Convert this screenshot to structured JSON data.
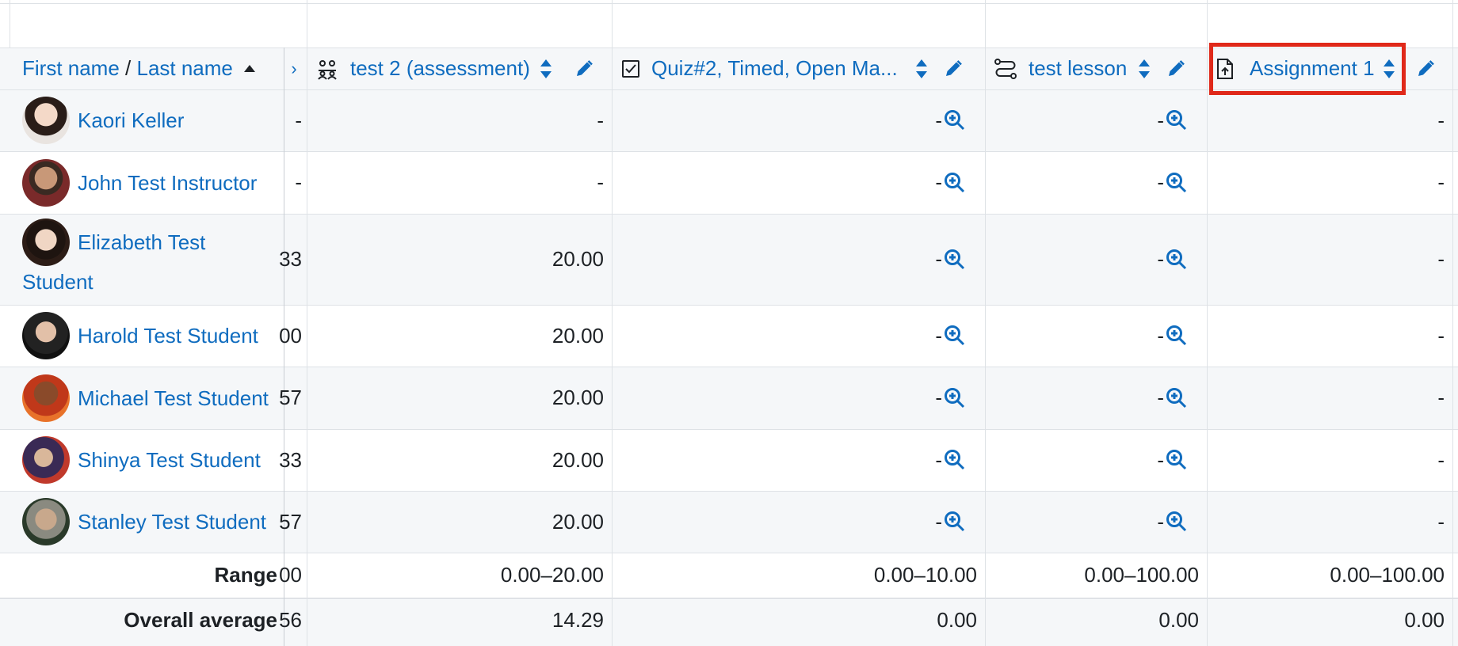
{
  "header": {
    "name_col": {
      "first": "First name",
      "sep": " / ",
      "last": "Last name"
    },
    "partial_col_glyph": "›",
    "columns": [
      {
        "label": "test 2 (assessment)",
        "icon": "workshop-icon"
      },
      {
        "label": "Quiz#2, Timed, Open Ma...",
        "icon": "quiz-checkbox-icon"
      },
      {
        "label": "test lesson",
        "icon": "lesson-path-icon"
      },
      {
        "label": "Assignment 1",
        "icon": "assignment-upload-icon"
      }
    ]
  },
  "students": [
    {
      "name": "Kaori Keller",
      "partial": "-",
      "values": [
        "-",
        "-",
        "-",
        "-"
      ]
    },
    {
      "name": "John Test Instructor",
      "partial": "-",
      "values": [
        "-",
        "-",
        "-",
        "-"
      ]
    },
    {
      "name_line1": "Elizabeth Test",
      "name_line2": "Student",
      "partial": "33",
      "values": [
        "20.00",
        "-",
        "-",
        "-"
      ]
    },
    {
      "name": "Harold Test Student",
      "partial": "00",
      "values": [
        "20.00",
        "-",
        "-",
        "-"
      ]
    },
    {
      "name": "Michael Test Student",
      "partial": "57",
      "values": [
        "20.00",
        "-",
        "-",
        "-"
      ]
    },
    {
      "name": "Shinya Test Student",
      "partial": "33",
      "values": [
        "20.00",
        "-",
        "-",
        "-"
      ]
    },
    {
      "name": "Stanley Test Student",
      "partial": "57",
      "values": [
        "20.00",
        "-",
        "-",
        "-"
      ]
    }
  ],
  "footer": {
    "range": {
      "label": "Range",
      "partial": "00",
      "values": [
        "0.00–20.00",
        "0.00–10.00",
        "0.00–100.00",
        "0.00–100.00"
      ]
    },
    "average": {
      "label": "Overall average",
      "partial": "56",
      "values": [
        "14.29",
        "0.00",
        "0.00",
        "0.00"
      ]
    }
  },
  "colors": {
    "link": "#0f6cbf",
    "highlight": "#e0291a",
    "stripe": "#f5f7f9"
  }
}
